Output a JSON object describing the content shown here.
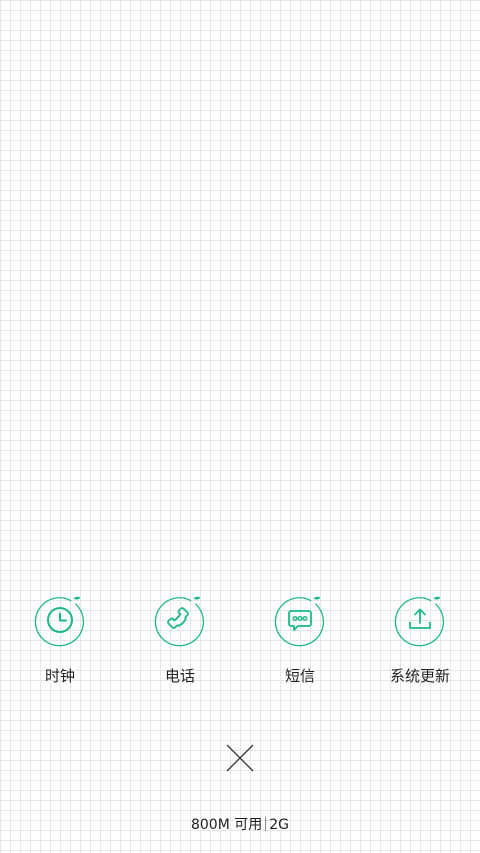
{
  "accent_color": "#1db985",
  "recent_apps": [
    {
      "label": "时钟",
      "icon": "clock-icon"
    },
    {
      "label": "电话",
      "icon": "phone-icon"
    },
    {
      "label": "短信",
      "icon": "message-icon"
    },
    {
      "label": "系统更新",
      "icon": "upload-icon"
    }
  ],
  "close_icon": "close-icon",
  "memory": {
    "available": "800M 可用",
    "total": "2G"
  }
}
